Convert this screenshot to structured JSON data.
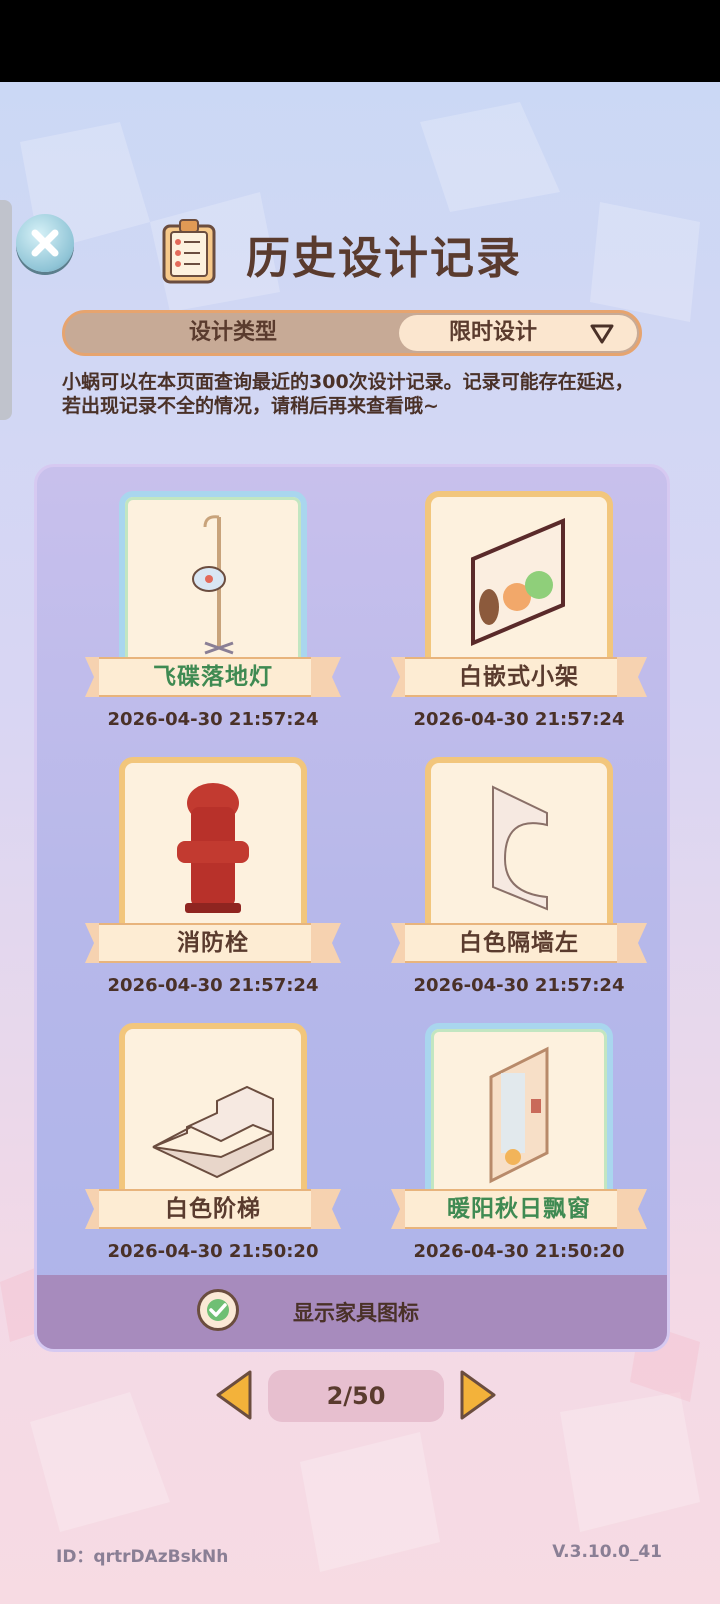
{
  "header": {
    "title": "历史设计记录"
  },
  "filter": {
    "type_label": "设计类型",
    "selected": "限时设计"
  },
  "notice": "小蜗可以在本页面查询最近的300次设计记录。记录可能存在延迟，若出现记录不全的情况，请稍后再来查看哦~",
  "records": [
    {
      "name": "飞碟落地灯",
      "time": "2026-04-30 21:57:24",
      "icon": "floor-lamp-icon",
      "frame": "blue"
    },
    {
      "name": "白嵌式小架",
      "time": "2026-04-30 21:57:24",
      "icon": "wall-shelf-icon",
      "frame": "gold"
    },
    {
      "name": "消防栓",
      "time": "2026-04-30 21:57:24",
      "icon": "fire-hydrant-icon",
      "frame": "gold"
    },
    {
      "name": "白色隔墙左",
      "time": "2026-04-30 21:57:24",
      "icon": "partition-wall-icon",
      "frame": "gold"
    },
    {
      "name": "白色阶梯",
      "time": "2026-04-30 21:50:20",
      "icon": "white-stairs-icon",
      "frame": "gold"
    },
    {
      "name": "暖阳秋日飘窗",
      "time": "2026-04-30 21:50:20",
      "icon": "bay-window-icon",
      "frame": "blue"
    }
  ],
  "toggle": {
    "label": "显示家具图标",
    "checked": true
  },
  "pager": {
    "text": "2/50"
  },
  "footer": {
    "id": "ID：qrtrDAzBskNh",
    "version": "V.3.10.0_41"
  },
  "colors": {
    "accent_text": "#5a3b2e",
    "highlight_green": "#3f8a52",
    "panel": "#b7b8ea",
    "pager_arrow": "#f3b23a"
  }
}
